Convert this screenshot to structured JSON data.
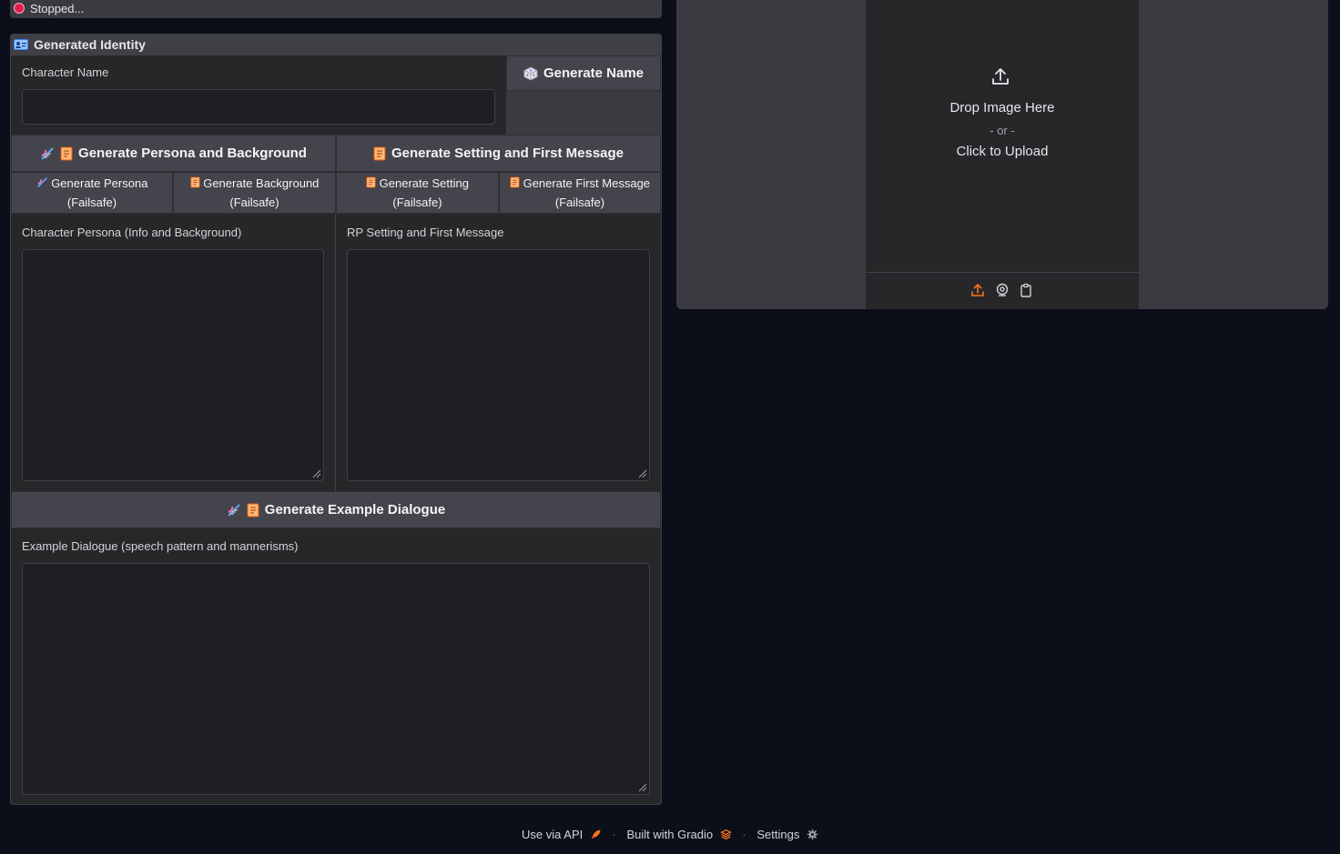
{
  "status": {
    "text": "Stopped..."
  },
  "identity": {
    "title": "Generated Identity",
    "title_icon": "id-card-icon",
    "name_label": "Character Name",
    "name_value": "",
    "generate_name_label": "Generate Name",
    "generate_name_icon": "dice-icon"
  },
  "generate": {
    "persona_background_label": "Generate Persona and Background",
    "setting_first_message_label": "Generate Setting and First Message",
    "persona_failsafe": [
      "Generate Persona",
      "(Failsafe)"
    ],
    "background_failsafe": [
      "Generate Background",
      "(Failsafe)"
    ],
    "setting_failsafe": [
      "Generate Setting",
      "(Failsafe)"
    ],
    "first_message_failsafe": [
      "Generate First Message",
      "(Failsafe)"
    ],
    "example_dialogue_label": "Generate Example Dialogue",
    "icons": [
      "dna-icon",
      "scroll-icon"
    ]
  },
  "fields": {
    "persona_label": "Character Persona (Info and Background)",
    "persona_value": "",
    "setting_label": "RP Setting and First Message",
    "setting_value": "",
    "dialogue_label": "Example Dialogue (speech pattern and mannerisms)",
    "dialogue_value": ""
  },
  "upload": {
    "drop_text": "Drop Image Here",
    "or_text": "- or -",
    "click_text": "Click to Upload",
    "tools": [
      "upload-icon",
      "webcam-icon",
      "clipboard-icon"
    ],
    "accent": "#f97316"
  },
  "footer": {
    "api_label": "Use via API",
    "built_label": "Built with Gradio",
    "settings_label": "Settings",
    "separator": "·"
  },
  "colors": {
    "status_dot": "#e11d48",
    "accent": "#f97316",
    "background": "#0b0f19",
    "panel": "#27272a"
  }
}
